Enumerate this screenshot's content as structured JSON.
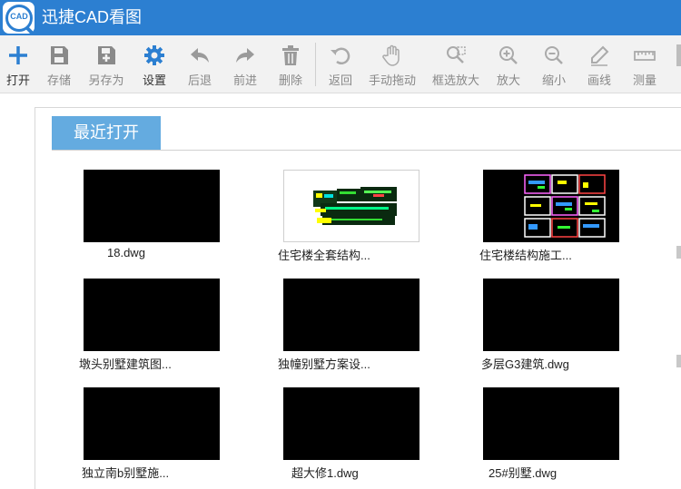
{
  "app": {
    "title": "迅捷CAD看图",
    "logo_text": "CAD"
  },
  "toolbar": [
    {
      "label": "打开",
      "icon": "plus-icon"
    },
    {
      "label": "存储",
      "icon": "save-icon"
    },
    {
      "label": "另存为",
      "icon": "save-as-icon"
    },
    {
      "label": "设置",
      "icon": "gear-icon"
    },
    {
      "label": "后退",
      "icon": "undo-arrow-icon"
    },
    {
      "label": "前进",
      "icon": "redo-arrow-icon"
    },
    {
      "label": "删除",
      "icon": "trash-icon"
    },
    {
      "label": "返回",
      "icon": "return-icon"
    },
    {
      "label": "手动拖动",
      "icon": "hand-icon"
    },
    {
      "label": "框选放大",
      "icon": "box-zoom-icon"
    },
    {
      "label": "放大",
      "icon": "zoom-in-icon"
    },
    {
      "label": "缩小",
      "icon": "zoom-out-icon"
    },
    {
      "label": "画线",
      "icon": "pencil-icon"
    },
    {
      "label": "测量",
      "icon": "ruler-icon"
    }
  ],
  "recent": {
    "tab_label": "最近打开",
    "files": [
      {
        "name": "18.dwg",
        "thumb": "black"
      },
      {
        "name": "住宅楼全套结构...",
        "thumb": "drawing-light"
      },
      {
        "name": "住宅楼结构施工...",
        "thumb": "drawing-dark"
      },
      {
        "name": "墩头别墅建筑图...",
        "thumb": "black"
      },
      {
        "name": "独幢别墅方案设...",
        "thumb": "black"
      },
      {
        "name": "多层G3建筑.dwg",
        "thumb": "black"
      },
      {
        "name": "独立南b别墅施...",
        "thumb": "black"
      },
      {
        "name": "超大修1.dwg",
        "thumb": "black"
      },
      {
        "name": "25#别墅.dwg",
        "thumb": "black"
      }
    ]
  }
}
